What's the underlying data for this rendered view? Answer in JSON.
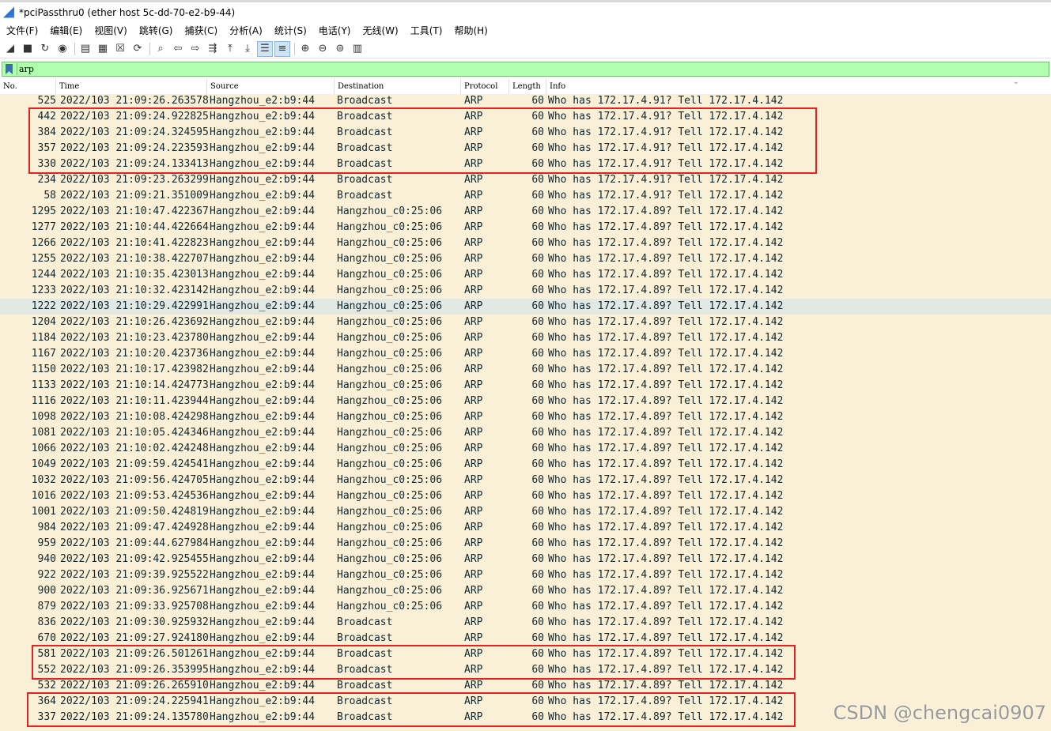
{
  "window": {
    "title": "*pciPassthru0 (ether host 5c-dd-70-e2-b9-44)"
  },
  "menu": [
    "文件(F)",
    "编辑(E)",
    "视图(V)",
    "跳转(G)",
    "捕获(C)",
    "分析(A)",
    "统计(S)",
    "电话(Y)",
    "无线(W)",
    "工具(T)",
    "帮助(H)"
  ],
  "toolbar": {
    "icons": [
      "start-capture-icon",
      "stop-capture-icon",
      "restart-capture-icon",
      "capture-options-icon",
      "open-file-icon",
      "save-file-icon",
      "close-file-icon",
      "reload-file-icon",
      "find-packet-icon",
      "go-back-icon",
      "go-forward-icon",
      "go-to-packet-icon",
      "first-packet-icon",
      "last-packet-icon",
      "autoscroll-icon",
      "colorize-icon",
      "zoom-in-icon",
      "zoom-out-icon",
      "zoom-normal-icon",
      "resize-columns-icon"
    ]
  },
  "filter": {
    "value": "arp",
    "background": "#afffaf"
  },
  "columns": [
    "No.",
    "Time",
    "Source",
    "Destination",
    "Protocol",
    "Length",
    "Info"
  ],
  "colors": {
    "row_background": "#faf0d7",
    "selected_row": "#e2e8e3",
    "highlight_box": "#e8201f"
  },
  "rows": [
    {
      "no": "525",
      "time": "2022/103 21:09:26.263578",
      "src": "Hangzhou_e2:b9:44",
      "dst": "Broadcast",
      "proto": "ARP",
      "len": "60",
      "info": "Who has 172.17.4.91? Tell 172.17.4.142"
    },
    {
      "no": "442",
      "time": "2022/103 21:09:24.922825",
      "src": "Hangzhou_e2:b9:44",
      "dst": "Broadcast",
      "proto": "ARP",
      "len": "60",
      "info": "Who has 172.17.4.91? Tell 172.17.4.142"
    },
    {
      "no": "384",
      "time": "2022/103 21:09:24.324595",
      "src": "Hangzhou_e2:b9:44",
      "dst": "Broadcast",
      "proto": "ARP",
      "len": "60",
      "info": "Who has 172.17.4.91? Tell 172.17.4.142"
    },
    {
      "no": "357",
      "time": "2022/103 21:09:24.223593",
      "src": "Hangzhou_e2:b9:44",
      "dst": "Broadcast",
      "proto": "ARP",
      "len": "60",
      "info": "Who has 172.17.4.91? Tell 172.17.4.142"
    },
    {
      "no": "330",
      "time": "2022/103 21:09:24.133413",
      "src": "Hangzhou_e2:b9:44",
      "dst": "Broadcast",
      "proto": "ARP",
      "len": "60",
      "info": "Who has 172.17.4.91? Tell 172.17.4.142"
    },
    {
      "no": "234",
      "time": "2022/103 21:09:23.263299",
      "src": "Hangzhou_e2:b9:44",
      "dst": "Broadcast",
      "proto": "ARP",
      "len": "60",
      "info": "Who has 172.17.4.91? Tell 172.17.4.142"
    },
    {
      "no": "58",
      "time": "2022/103 21:09:21.351009",
      "src": "Hangzhou_e2:b9:44",
      "dst": "Broadcast",
      "proto": "ARP",
      "len": "60",
      "info": "Who has 172.17.4.91? Tell 172.17.4.142"
    },
    {
      "no": "1295",
      "time": "2022/103 21:10:47.422367",
      "src": "Hangzhou_e2:b9:44",
      "dst": "Hangzhou_c0:25:06",
      "proto": "ARP",
      "len": "60",
      "info": "Who has 172.17.4.89? Tell 172.17.4.142"
    },
    {
      "no": "1277",
      "time": "2022/103 21:10:44.422664",
      "src": "Hangzhou_e2:b9:44",
      "dst": "Hangzhou_c0:25:06",
      "proto": "ARP",
      "len": "60",
      "info": "Who has 172.17.4.89? Tell 172.17.4.142"
    },
    {
      "no": "1266",
      "time": "2022/103 21:10:41.422823",
      "src": "Hangzhou_e2:b9:44",
      "dst": "Hangzhou_c0:25:06",
      "proto": "ARP",
      "len": "60",
      "info": "Who has 172.17.4.89? Tell 172.17.4.142"
    },
    {
      "no": "1255",
      "time": "2022/103 21:10:38.422707",
      "src": "Hangzhou_e2:b9:44",
      "dst": "Hangzhou_c0:25:06",
      "proto": "ARP",
      "len": "60",
      "info": "Who has 172.17.4.89? Tell 172.17.4.142"
    },
    {
      "no": "1244",
      "time": "2022/103 21:10:35.423013",
      "src": "Hangzhou_e2:b9:44",
      "dst": "Hangzhou_c0:25:06",
      "proto": "ARP",
      "len": "60",
      "info": "Who has 172.17.4.89? Tell 172.17.4.142"
    },
    {
      "no": "1233",
      "time": "2022/103 21:10:32.423142",
      "src": "Hangzhou_e2:b9:44",
      "dst": "Hangzhou_c0:25:06",
      "proto": "ARP",
      "len": "60",
      "info": "Who has 172.17.4.89? Tell 172.17.4.142"
    },
    {
      "no": "1222",
      "time": "2022/103 21:10:29.422991",
      "src": "Hangzhou_e2:b9:44",
      "dst": "Hangzhou_c0:25:06",
      "proto": "ARP",
      "len": "60",
      "info": "Who has 172.17.4.89? Tell 172.17.4.142",
      "selected": true
    },
    {
      "no": "1204",
      "time": "2022/103 21:10:26.423692",
      "src": "Hangzhou_e2:b9:44",
      "dst": "Hangzhou_c0:25:06",
      "proto": "ARP",
      "len": "60",
      "info": "Who has 172.17.4.89? Tell 172.17.4.142"
    },
    {
      "no": "1184",
      "time": "2022/103 21:10:23.423780",
      "src": "Hangzhou_e2:b9:44",
      "dst": "Hangzhou_c0:25:06",
      "proto": "ARP",
      "len": "60",
      "info": "Who has 172.17.4.89? Tell 172.17.4.142"
    },
    {
      "no": "1167",
      "time": "2022/103 21:10:20.423736",
      "src": "Hangzhou_e2:b9:44",
      "dst": "Hangzhou_c0:25:06",
      "proto": "ARP",
      "len": "60",
      "info": "Who has 172.17.4.89? Tell 172.17.4.142"
    },
    {
      "no": "1150",
      "time": "2022/103 21:10:17.423982",
      "src": "Hangzhou_e2:b9:44",
      "dst": "Hangzhou_c0:25:06",
      "proto": "ARP",
      "len": "60",
      "info": "Who has 172.17.4.89? Tell 172.17.4.142"
    },
    {
      "no": "1133",
      "time": "2022/103 21:10:14.424773",
      "src": "Hangzhou_e2:b9:44",
      "dst": "Hangzhou_c0:25:06",
      "proto": "ARP",
      "len": "60",
      "info": "Who has 172.17.4.89? Tell 172.17.4.142"
    },
    {
      "no": "1116",
      "time": "2022/103 21:10:11.423944",
      "src": "Hangzhou_e2:b9:44",
      "dst": "Hangzhou_c0:25:06",
      "proto": "ARP",
      "len": "60",
      "info": "Who has 172.17.4.89? Tell 172.17.4.142"
    },
    {
      "no": "1098",
      "time": "2022/103 21:10:08.424298",
      "src": "Hangzhou_e2:b9:44",
      "dst": "Hangzhou_c0:25:06",
      "proto": "ARP",
      "len": "60",
      "info": "Who has 172.17.4.89? Tell 172.17.4.142"
    },
    {
      "no": "1081",
      "time": "2022/103 21:10:05.424346",
      "src": "Hangzhou_e2:b9:44",
      "dst": "Hangzhou_c0:25:06",
      "proto": "ARP",
      "len": "60",
      "info": "Who has 172.17.4.89? Tell 172.17.4.142"
    },
    {
      "no": "1066",
      "time": "2022/103 21:10:02.424248",
      "src": "Hangzhou_e2:b9:44",
      "dst": "Hangzhou_c0:25:06",
      "proto": "ARP",
      "len": "60",
      "info": "Who has 172.17.4.89? Tell 172.17.4.142"
    },
    {
      "no": "1049",
      "time": "2022/103 21:09:59.424541",
      "src": "Hangzhou_e2:b9:44",
      "dst": "Hangzhou_c0:25:06",
      "proto": "ARP",
      "len": "60",
      "info": "Who has 172.17.4.89? Tell 172.17.4.142"
    },
    {
      "no": "1032",
      "time": "2022/103 21:09:56.424705",
      "src": "Hangzhou_e2:b9:44",
      "dst": "Hangzhou_c0:25:06",
      "proto": "ARP",
      "len": "60",
      "info": "Who has 172.17.4.89? Tell 172.17.4.142"
    },
    {
      "no": "1016",
      "time": "2022/103 21:09:53.424536",
      "src": "Hangzhou_e2:b9:44",
      "dst": "Hangzhou_c0:25:06",
      "proto": "ARP",
      "len": "60",
      "info": "Who has 172.17.4.89? Tell 172.17.4.142"
    },
    {
      "no": "1001",
      "time": "2022/103 21:09:50.424819",
      "src": "Hangzhou_e2:b9:44",
      "dst": "Hangzhou_c0:25:06",
      "proto": "ARP",
      "len": "60",
      "info": "Who has 172.17.4.89? Tell 172.17.4.142"
    },
    {
      "no": "984",
      "time": "2022/103 21:09:47.424928",
      "src": "Hangzhou_e2:b9:44",
      "dst": "Hangzhou_c0:25:06",
      "proto": "ARP",
      "len": "60",
      "info": "Who has 172.17.4.89? Tell 172.17.4.142"
    },
    {
      "no": "959",
      "time": "2022/103 21:09:44.627984",
      "src": "Hangzhou_e2:b9:44",
      "dst": "Hangzhou_c0:25:06",
      "proto": "ARP",
      "len": "60",
      "info": "Who has 172.17.4.89? Tell 172.17.4.142"
    },
    {
      "no": "940",
      "time": "2022/103 21:09:42.925455",
      "src": "Hangzhou_e2:b9:44",
      "dst": "Hangzhou_c0:25:06",
      "proto": "ARP",
      "len": "60",
      "info": "Who has 172.17.4.89? Tell 172.17.4.142"
    },
    {
      "no": "922",
      "time": "2022/103 21:09:39.925522",
      "src": "Hangzhou_e2:b9:44",
      "dst": "Hangzhou_c0:25:06",
      "proto": "ARP",
      "len": "60",
      "info": "Who has 172.17.4.89? Tell 172.17.4.142"
    },
    {
      "no": "900",
      "time": "2022/103 21:09:36.925671",
      "src": "Hangzhou_e2:b9:44",
      "dst": "Hangzhou_c0:25:06",
      "proto": "ARP",
      "len": "60",
      "info": "Who has 172.17.4.89? Tell 172.17.4.142"
    },
    {
      "no": "879",
      "time": "2022/103 21:09:33.925708",
      "src": "Hangzhou_e2:b9:44",
      "dst": "Hangzhou_c0:25:06",
      "proto": "ARP",
      "len": "60",
      "info": "Who has 172.17.4.89? Tell 172.17.4.142"
    },
    {
      "no": "836",
      "time": "2022/103 21:09:30.925932",
      "src": "Hangzhou_e2:b9:44",
      "dst": "Broadcast",
      "proto": "ARP",
      "len": "60",
      "info": "Who has 172.17.4.89? Tell 172.17.4.142"
    },
    {
      "no": "670",
      "time": "2022/103 21:09:27.924180",
      "src": "Hangzhou_e2:b9:44",
      "dst": "Broadcast",
      "proto": "ARP",
      "len": "60",
      "info": "Who has 172.17.4.89? Tell 172.17.4.142"
    },
    {
      "no": "581",
      "time": "2022/103 21:09:26.501261",
      "src": "Hangzhou_e2:b9:44",
      "dst": "Broadcast",
      "proto": "ARP",
      "len": "60",
      "info": "Who has 172.17.4.89? Tell 172.17.4.142"
    },
    {
      "no": "552",
      "time": "2022/103 21:09:26.353995",
      "src": "Hangzhou_e2:b9:44",
      "dst": "Broadcast",
      "proto": "ARP",
      "len": "60",
      "info": "Who has 172.17.4.89? Tell 172.17.4.142"
    },
    {
      "no": "532",
      "time": "2022/103 21:09:26.265910",
      "src": "Hangzhou_e2:b9:44",
      "dst": "Broadcast",
      "proto": "ARP",
      "len": "60",
      "info": "Who has 172.17.4.89? Tell 172.17.4.142"
    },
    {
      "no": "364",
      "time": "2022/103 21:09:24.225941",
      "src": "Hangzhou_e2:b9:44",
      "dst": "Broadcast",
      "proto": "ARP",
      "len": "60",
      "info": "Who has 172.17.4.89? Tell 172.17.4.142"
    },
    {
      "no": "337",
      "time": "2022/103 21:09:24.135780",
      "src": "Hangzhou_e2:b9:44",
      "dst": "Broadcast",
      "proto": "ARP",
      "len": "60",
      "info": "Who has 172.17.4.89? Tell 172.17.4.142"
    }
  ],
  "highlights": [
    {
      "first_row": 1,
      "last_row": 4
    },
    {
      "first_row": 35,
      "last_row": 36
    },
    {
      "first_row": 38,
      "last_row": 39
    }
  ],
  "watermark": "CSDN @chengcai0907"
}
